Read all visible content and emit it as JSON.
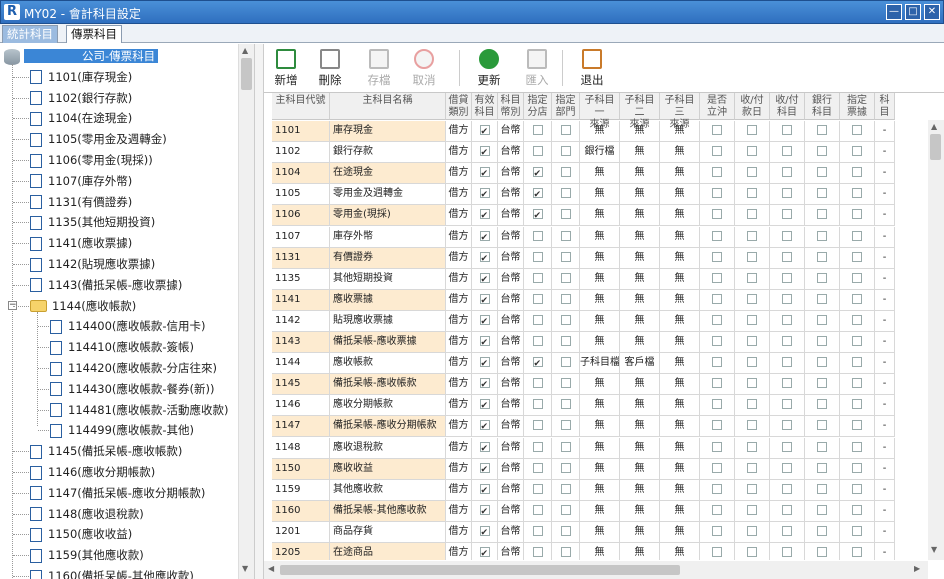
{
  "window": {
    "title": "MY02 - 會計科目設定",
    "logo": "R",
    "min": "—",
    "max": "□",
    "close": "✕"
  },
  "tabs": [
    {
      "label": "統計科目",
      "active": false
    },
    {
      "label": "傳票科目",
      "active": true
    }
  ],
  "tree": {
    "root": "公司-傳票科目",
    "items": [
      {
        "label": "1101(庫存現金)",
        "level": 1
      },
      {
        "label": "1102(銀行存款)",
        "level": 1
      },
      {
        "label": "1104(在途現金)",
        "level": 1
      },
      {
        "label": "1105(零用金及週轉金)",
        "level": 1
      },
      {
        "label": "1106(零用金(現採))",
        "level": 1
      },
      {
        "label": "1107(庫存外幣)",
        "level": 1
      },
      {
        "label": "1131(有價證券)",
        "level": 1
      },
      {
        "label": "1135(其他短期投資)",
        "level": 1
      },
      {
        "label": "1141(應收票據)",
        "level": 1
      },
      {
        "label": "1142(貼現應收票據)",
        "level": 1
      },
      {
        "label": "1143(備抵呆帳-應收票據)",
        "level": 1
      },
      {
        "label": "1144(應收帳款)",
        "level": 1,
        "expanded": true
      },
      {
        "label": "114400(應收帳款-信用卡)",
        "level": 2
      },
      {
        "label": "114410(應收帳款-簽帳)",
        "level": 2
      },
      {
        "label": "114420(應收帳款-分店往來)",
        "level": 2
      },
      {
        "label": "114430(應收帳款-餐券(新))",
        "level": 2
      },
      {
        "label": "114481(應收帳款-活動應收款)",
        "level": 2
      },
      {
        "label": "114499(應收帳款-其他)",
        "level": 2
      },
      {
        "label": "1145(備抵呆帳-應收帳款)",
        "level": 1
      },
      {
        "label": "1146(應收分期帳款)",
        "level": 1
      },
      {
        "label": "1147(備抵呆帳-應收分期帳款)",
        "level": 1
      },
      {
        "label": "1148(應收退稅款)",
        "level": 1
      },
      {
        "label": "1150(應收收益)",
        "level": 1
      },
      {
        "label": "1159(其他應收款)",
        "level": 1
      },
      {
        "label": "1160(備抵呆帳-其他應收款)",
        "level": 1
      }
    ]
  },
  "toolbar": [
    {
      "label": "新增",
      "icon": "add-document-icon",
      "enabled": true
    },
    {
      "label": "刪除",
      "icon": "trash-icon",
      "enabled": true
    },
    {
      "label": "存檔",
      "icon": "save-icon",
      "enabled": false
    },
    {
      "label": "取消",
      "icon": "cancel-icon",
      "enabled": false
    },
    {
      "label": "更新",
      "icon": "refresh-icon",
      "enabled": true
    },
    {
      "label": "匯入",
      "icon": "import-icon",
      "enabled": false
    },
    {
      "label": "退出",
      "icon": "exit-door-icon",
      "enabled": true
    }
  ],
  "grid": {
    "columns": [
      {
        "label": "主科目代號"
      },
      {
        "label": "主科目名稱"
      },
      {
        "label": "借貸\n類別"
      },
      {
        "label": "有效\n科目"
      },
      {
        "label": "科目\n幣別"
      },
      {
        "label": "指定\n分店"
      },
      {
        "label": "指定\n部門"
      },
      {
        "label": "子科目一\n來源"
      },
      {
        "label": "子科目二\n來源"
      },
      {
        "label": "子科目三\n來源"
      },
      {
        "label": "是否\n立沖"
      },
      {
        "label": "收/付\n款日"
      },
      {
        "label": "收/付\n科目"
      },
      {
        "label": "銀行\n科目"
      },
      {
        "label": "指定\n票據"
      },
      {
        "label": "科目"
      }
    ],
    "rows": [
      {
        "code": "1101",
        "name": "庫存現金",
        "dc": "借方",
        "valid": true,
        "cur": "台幣",
        "store": false,
        "dept": false,
        "s1": "無",
        "s2": "無",
        "s3": "無",
        "hl": true
      },
      {
        "code": "1102",
        "name": "銀行存款",
        "dc": "借方",
        "valid": true,
        "cur": "台幣",
        "store": false,
        "dept": false,
        "s1": "銀行檔",
        "s2": "無",
        "s3": "無",
        "hl": false
      },
      {
        "code": "1104",
        "name": "在途現金",
        "dc": "借方",
        "valid": true,
        "cur": "台幣",
        "store": true,
        "dept": false,
        "s1": "無",
        "s2": "無",
        "s3": "無",
        "hl": true
      },
      {
        "code": "1105",
        "name": "零用金及週轉金",
        "dc": "借方",
        "valid": true,
        "cur": "台幣",
        "store": true,
        "dept": false,
        "s1": "無",
        "s2": "無",
        "s3": "無",
        "hl": false
      },
      {
        "code": "1106",
        "name": "零用金(現採)",
        "dc": "借方",
        "valid": true,
        "cur": "台幣",
        "store": true,
        "dept": false,
        "s1": "無",
        "s2": "無",
        "s3": "無",
        "hl": true
      },
      {
        "code": "1107",
        "name": "庫存外幣",
        "dc": "借方",
        "valid": true,
        "cur": "台幣",
        "store": false,
        "dept": false,
        "s1": "無",
        "s2": "無",
        "s3": "無",
        "hl": false
      },
      {
        "code": "1131",
        "name": "有價證券",
        "dc": "借方",
        "valid": true,
        "cur": "台幣",
        "store": false,
        "dept": false,
        "s1": "無",
        "s2": "無",
        "s3": "無",
        "hl": true
      },
      {
        "code": "1135",
        "name": "其他短期投資",
        "dc": "借方",
        "valid": true,
        "cur": "台幣",
        "store": false,
        "dept": false,
        "s1": "無",
        "s2": "無",
        "s3": "無",
        "hl": false
      },
      {
        "code": "1141",
        "name": "應收票據",
        "dc": "借方",
        "valid": true,
        "cur": "台幣",
        "store": false,
        "dept": false,
        "s1": "無",
        "s2": "無",
        "s3": "無",
        "hl": true
      },
      {
        "code": "1142",
        "name": "貼現應收票據",
        "dc": "借方",
        "valid": true,
        "cur": "台幣",
        "store": false,
        "dept": false,
        "s1": "無",
        "s2": "無",
        "s3": "無",
        "hl": false
      },
      {
        "code": "1143",
        "name": "備抵呆帳-應收票據",
        "dc": "借方",
        "valid": true,
        "cur": "台幣",
        "store": false,
        "dept": false,
        "s1": "無",
        "s2": "無",
        "s3": "無",
        "hl": true
      },
      {
        "code": "1144",
        "name": "應收帳款",
        "dc": "借方",
        "valid": true,
        "cur": "台幣",
        "store": true,
        "dept": false,
        "s1": "子科目檔",
        "s2": "客戶檔",
        "s3": "無",
        "hl": false
      },
      {
        "code": "1145",
        "name": "備抵呆帳-應收帳款",
        "dc": "借方",
        "valid": true,
        "cur": "台幣",
        "store": false,
        "dept": false,
        "s1": "無",
        "s2": "無",
        "s3": "無",
        "hl": true
      },
      {
        "code": "1146",
        "name": "應收分期帳款",
        "dc": "借方",
        "valid": true,
        "cur": "台幣",
        "store": false,
        "dept": false,
        "s1": "無",
        "s2": "無",
        "s3": "無",
        "hl": false
      },
      {
        "code": "1147",
        "name": "備抵呆帳-應收分期帳款",
        "dc": "借方",
        "valid": true,
        "cur": "台幣",
        "store": false,
        "dept": false,
        "s1": "無",
        "s2": "無",
        "s3": "無",
        "hl": true
      },
      {
        "code": "1148",
        "name": "應收退稅款",
        "dc": "借方",
        "valid": true,
        "cur": "台幣",
        "store": false,
        "dept": false,
        "s1": "無",
        "s2": "無",
        "s3": "無",
        "hl": false
      },
      {
        "code": "1150",
        "name": "應收收益",
        "dc": "借方",
        "valid": true,
        "cur": "台幣",
        "store": false,
        "dept": false,
        "s1": "無",
        "s2": "無",
        "s3": "無",
        "hl": true
      },
      {
        "code": "1159",
        "name": "其他應收款",
        "dc": "借方",
        "valid": true,
        "cur": "台幣",
        "store": false,
        "dept": false,
        "s1": "無",
        "s2": "無",
        "s3": "無",
        "hl": false
      },
      {
        "code": "1160",
        "name": "備抵呆帳-其他應收款",
        "dc": "借方",
        "valid": true,
        "cur": "台幣",
        "store": false,
        "dept": false,
        "s1": "無",
        "s2": "無",
        "s3": "無",
        "hl": true
      },
      {
        "code": "1201",
        "name": "商品存貨",
        "dc": "借方",
        "valid": true,
        "cur": "台幣",
        "store": false,
        "dept": false,
        "s1": "無",
        "s2": "無",
        "s3": "無",
        "hl": false
      },
      {
        "code": "1205",
        "name": "在途商品",
        "dc": "借方",
        "valid": true,
        "cur": "台幣",
        "store": false,
        "dept": false,
        "s1": "無",
        "s2": "無",
        "s3": "無",
        "hl": true
      }
    ]
  },
  "colors": {
    "row_highlight": "#fdebd0",
    "accent": "#2f6fbf"
  }
}
